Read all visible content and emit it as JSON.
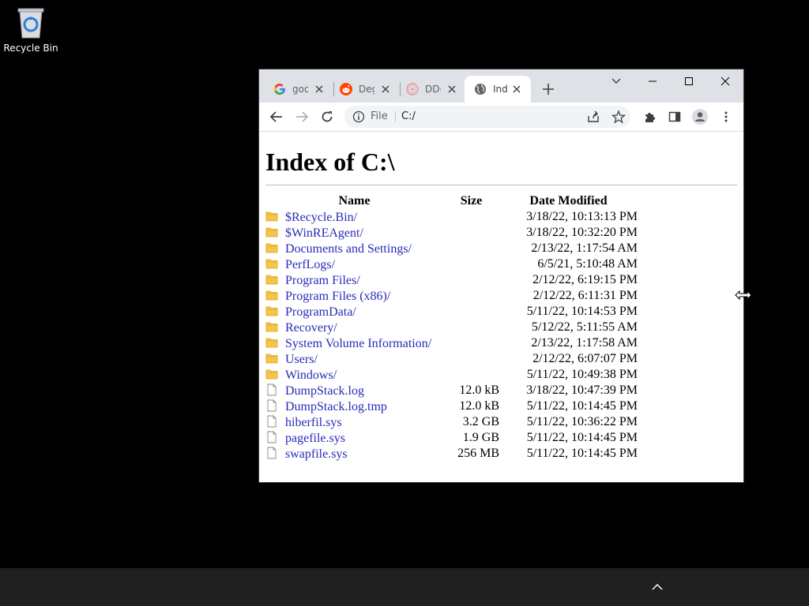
{
  "desktop": {
    "recycle_bin_label": "Recycle Bin"
  },
  "browser": {
    "tabs": [
      {
        "title": "goo",
        "favicon": "google-icon",
        "active": false
      },
      {
        "title": "Deg",
        "favicon": "reddit-icon",
        "active": false
      },
      {
        "title": "DD(",
        "favicon": "ddg-icon",
        "active": false
      },
      {
        "title": "Ind",
        "favicon": "globe-icon",
        "active": true
      }
    ],
    "omnibox": {
      "scheme_label": "File",
      "url": "C:/"
    }
  },
  "page": {
    "heading": "Index of C:\\",
    "columns": {
      "name": "Name",
      "size": "Size",
      "date": "Date Modified"
    },
    "entries": [
      {
        "name": "$Recycle.Bin/",
        "size": "",
        "date": "3/18/22, 10:13:13 PM",
        "type": "folder"
      },
      {
        "name": "$WinREAgent/",
        "size": "",
        "date": "3/18/22, 10:32:20 PM",
        "type": "folder"
      },
      {
        "name": "Documents and Settings/",
        "size": "",
        "date": "2/13/22, 1:17:54 AM",
        "type": "folder"
      },
      {
        "name": "PerfLogs/",
        "size": "",
        "date": "6/5/21, 5:10:48 AM",
        "type": "folder"
      },
      {
        "name": "Program Files/",
        "size": "",
        "date": "2/12/22, 6:19:15 PM",
        "type": "folder"
      },
      {
        "name": "Program Files (x86)/",
        "size": "",
        "date": "2/12/22, 6:11:31 PM",
        "type": "folder"
      },
      {
        "name": "ProgramData/",
        "size": "",
        "date": "5/11/22, 10:14:53 PM",
        "type": "folder"
      },
      {
        "name": "Recovery/",
        "size": "",
        "date": "5/12/22, 5:11:55 AM",
        "type": "folder"
      },
      {
        "name": "System Volume Information/",
        "size": "",
        "date": "2/13/22, 1:17:58 AM",
        "type": "folder"
      },
      {
        "name": "Users/",
        "size": "",
        "date": "2/12/22, 6:07:07 PM",
        "type": "folder"
      },
      {
        "name": "Windows/",
        "size": "",
        "date": "5/11/22, 10:49:38 PM",
        "type": "folder"
      },
      {
        "name": "DumpStack.log",
        "size": "12.0 kB",
        "date": "3/18/22, 10:47:39 PM",
        "type": "file"
      },
      {
        "name": "DumpStack.log.tmp",
        "size": "12.0 kB",
        "date": "5/11/22, 10:14:45 PM",
        "type": "file"
      },
      {
        "name": "hiberfil.sys",
        "size": "3.2 GB",
        "date": "5/11/22, 10:36:22 PM",
        "type": "file"
      },
      {
        "name": "pagefile.sys",
        "size": "1.9 GB",
        "date": "5/11/22, 10:14:45 PM",
        "type": "file"
      },
      {
        "name": "swapfile.sys",
        "size": "256 MB",
        "date": "5/11/22, 10:14:45 PM",
        "type": "file"
      }
    ]
  },
  "colors": {
    "link": "#2a2ab8",
    "tabstrip": "#dee1e6",
    "folder": "#f2c54b",
    "taskbar": "#202020"
  }
}
